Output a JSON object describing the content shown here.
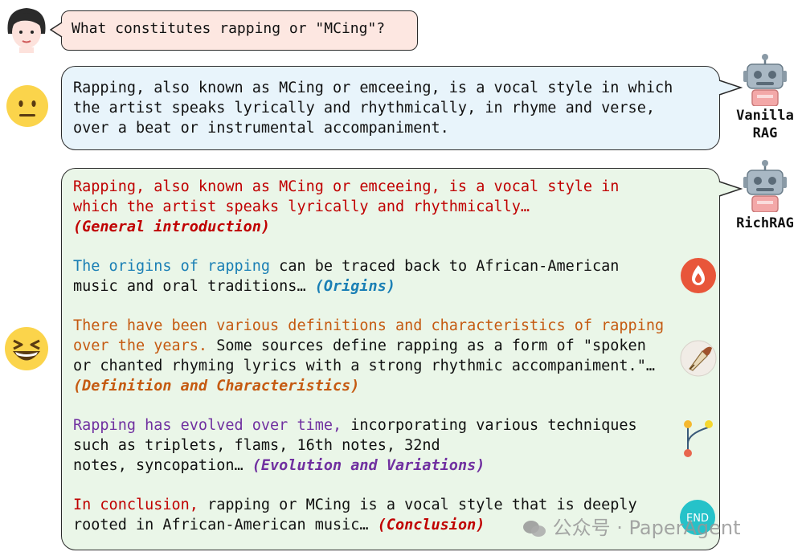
{
  "question": {
    "text": "What constitutes rapping or \"MCing\"?"
  },
  "vanilla": {
    "label_line1": "Vanilla",
    "label_line2": "RAG",
    "lines": [
      "Rapping, also known as MCing or emceeing, is a vocal style in which",
      "the artist speaks lyrically and rhythmically, in rhyme and verse,",
      "over a beat or instrumental accompaniment."
    ]
  },
  "rich": {
    "label": "RichRAG",
    "intro": {
      "line1": "Rapping, also known as MCing or emceeing, is a vocal style in",
      "line2": "which the artist speaks lyrically and rhythmically…",
      "tag": "(General introduction)"
    },
    "origins": {
      "highlight": "The origins of rapping",
      "text1": " can be traced back to African-American",
      "text2": "music and oral traditions… ",
      "tag": "(Origins)"
    },
    "definition": {
      "highlight1": "There have been various definitions and characteristics of rapping",
      "highlight2": "over the years.",
      "text2": " Some sources define rapping as a form of \"spoken",
      "text3": "or chanted rhyming lyrics with a strong rhythmic accompaniment.\"…",
      "tag": "(Definition and Characteristics)"
    },
    "evolution": {
      "highlight": "Rapping has evolved over time,",
      "text1": " incorporating various techniques",
      "text2": "such as triplets, flams, 16th notes, 32nd",
      "text3": "notes, syncopation… ",
      "tag": "(Evolution and Variations)"
    },
    "conclusion": {
      "highlight": "In conclusion,",
      "text1": " rapping or MCing is a vocal style that is deeply",
      "text2": "rooted in African-American music… ",
      "tag": "(Conclusion)"
    },
    "end_icon_text": "END"
  },
  "watermark": "公众号 · PaperAgent",
  "icons": [
    "user-avatar-icon",
    "neutral-face-emoji-icon",
    "grinning-squint-emoji-icon",
    "robot-icon",
    "fire-drop-icon",
    "quill-pen-icon",
    "branch-icon",
    "end-badge-icon"
  ],
  "colors": {
    "red": "#c00000",
    "blue": "#1a7fb5",
    "orange": "#c55a11",
    "purple": "#7030a0",
    "question_bg": "#fde7e1",
    "vanilla_bg": "#e8f4fb",
    "rich_bg": "#eaf6e8"
  }
}
